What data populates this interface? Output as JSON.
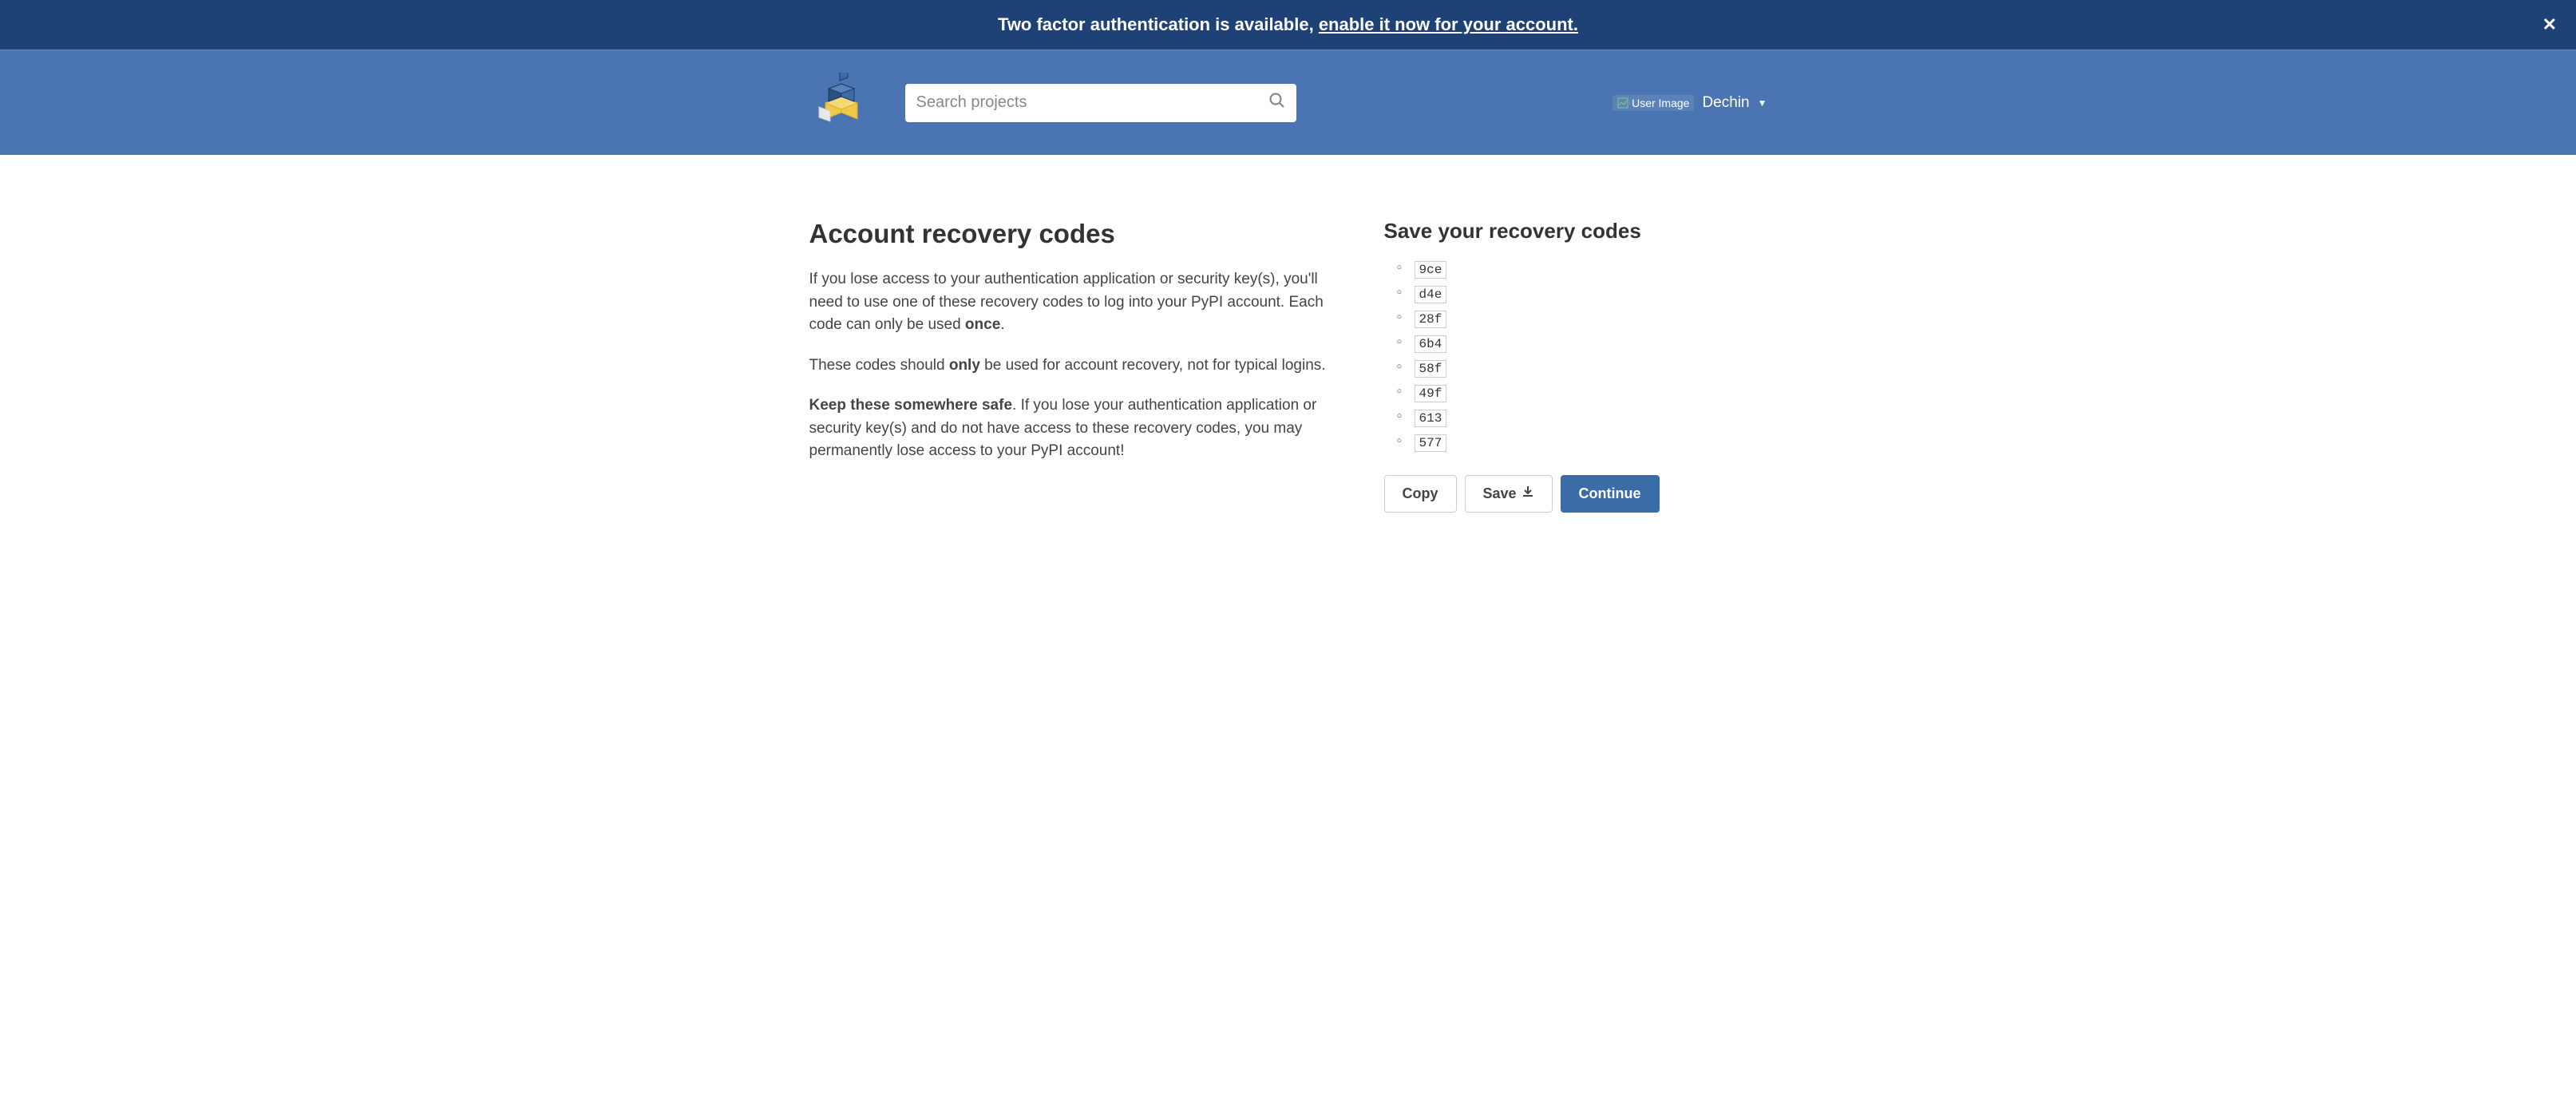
{
  "banner": {
    "text_prefix": "Two factor authentication is available, ",
    "link_text": "enable it now for your account."
  },
  "header": {
    "search_placeholder": "Search projects",
    "user_image_alt": "User Image",
    "username": "Dechin"
  },
  "left": {
    "title": "Account recovery codes",
    "p1_a": "If you lose access to your authentication application or security key(s), you'll need to use one of these recovery codes to log into your PyPI account. Each code can only be used ",
    "p1_strong": "once",
    "p1_b": ".",
    "p2_a": "These codes should ",
    "p2_strong": "only",
    "p2_b": " be used for account recovery, not for typical logins.",
    "p3_strong": "Keep these somewhere safe",
    "p3_a": ". If you lose your authentication application or security key(s) and do not have access to these recovery codes, you may permanently lose access to your PyPI account!"
  },
  "right": {
    "title": "Save your recovery codes",
    "codes": [
      "9ce",
      "d4e",
      "28f",
      "6b4",
      "58f",
      "49f",
      "613",
      "577"
    ],
    "copy_label": "Copy",
    "save_label": "Save",
    "continue_label": "Continue"
  }
}
